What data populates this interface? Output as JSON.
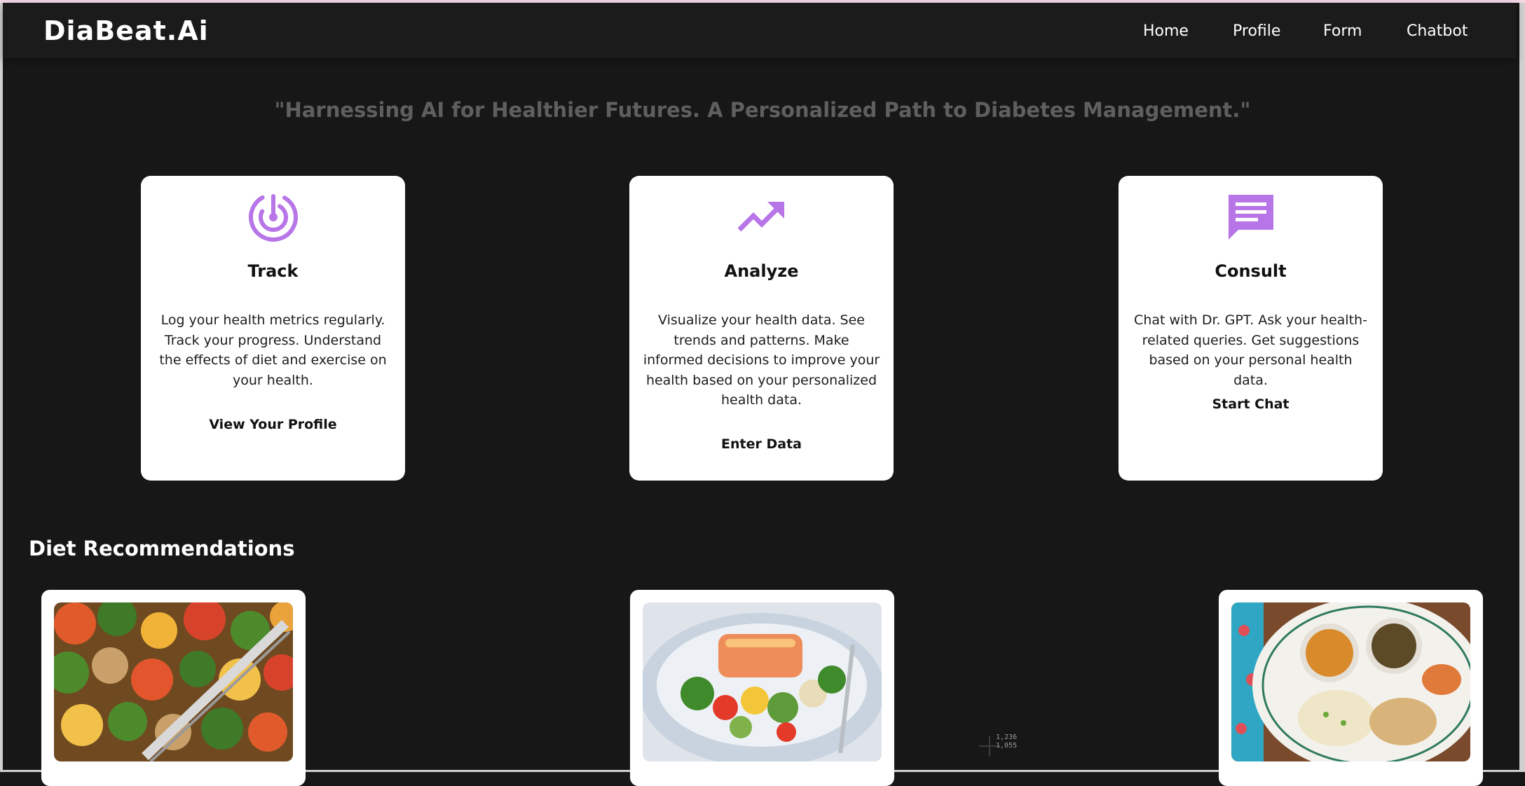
{
  "brand": "DiaBeat.Ai",
  "nav": {
    "home": "Home",
    "profile": "Profile",
    "form": "Form",
    "chatbot": "Chatbot"
  },
  "tagline": "\"Harnessing AI for Healthier Futures. A Personalized Path to Diabetes Management.\"",
  "features": [
    {
      "icon": "radar-target-icon",
      "title": "Track",
      "description": "Log your health metrics regularly. Track your progress. Understand the effects of diet and exercise on your health.",
      "action": "View Your Profile"
    },
    {
      "icon": "trending-up-icon",
      "title": "Analyze",
      "description": "Visualize your health data. See trends and patterns. Make informed decisions to improve your health based on your personalized health data.",
      "action": "Enter Data"
    },
    {
      "icon": "chat-bubble-icon",
      "title": "Consult",
      "description": "Chat with Dr. GPT. Ask your health-related queries. Get suggestions based on your personal health data.",
      "action": "Start Chat"
    }
  ],
  "diet_section_title": "Diet Recommendations",
  "diet_images": [
    "roasted-vegetables-chicken-photo",
    "salmon-vegetables-plate-photo",
    "indian-thali-plate-photo"
  ],
  "colors": {
    "accent": "#b775e8",
    "background": "#171717",
    "navbar": "#1b1b1b",
    "card": "#ffffff",
    "tagline": "#5f5f5f"
  },
  "cursor_coords": [
    "1,236",
    "1,055"
  ]
}
